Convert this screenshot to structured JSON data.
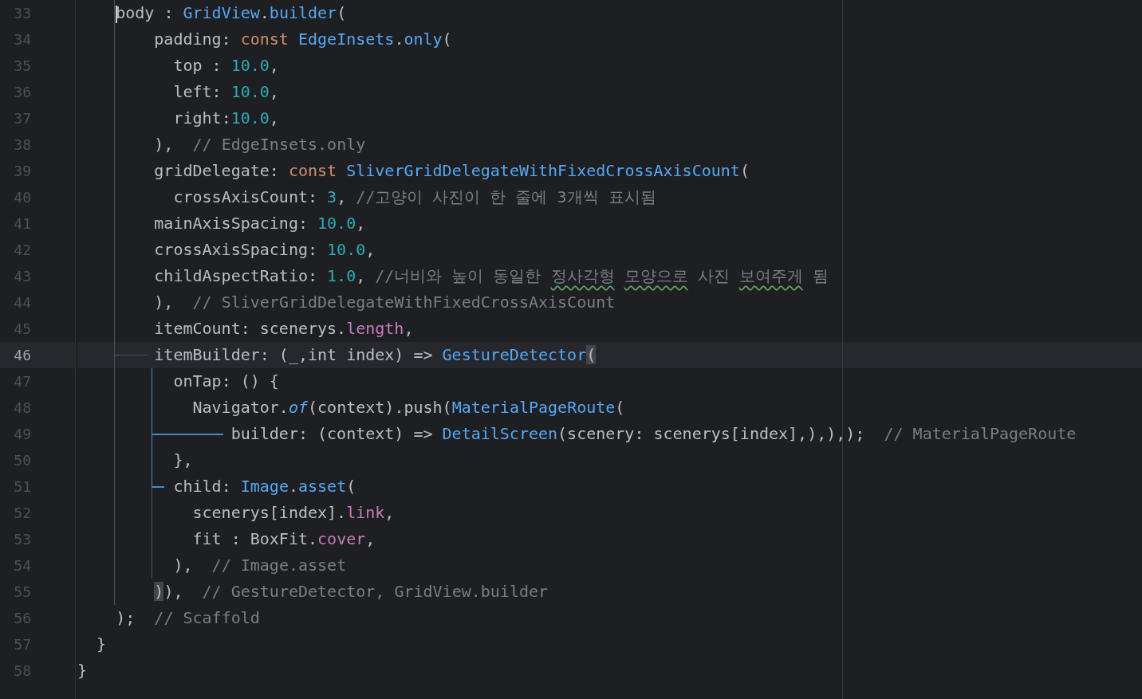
{
  "lines": [
    {
      "number": "33",
      "current": false,
      "caret": true,
      "tokens": [
        {
          "kind": "plain",
          "text": "    body : "
        },
        {
          "kind": "call",
          "text": "GridView"
        },
        {
          "kind": "plain",
          "text": "."
        },
        {
          "kind": "call",
          "text": "builder"
        },
        {
          "kind": "plain",
          "text": "("
        }
      ]
    },
    {
      "number": "34",
      "current": false,
      "tokens": [
        {
          "kind": "plain",
          "text": "        padding: "
        },
        {
          "kind": "keyword",
          "text": "const"
        },
        {
          "kind": "call",
          "text": " EdgeInsets"
        },
        {
          "kind": "plain",
          "text": "."
        },
        {
          "kind": "call",
          "text": "only"
        },
        {
          "kind": "plain",
          "text": "("
        }
      ]
    },
    {
      "number": "35",
      "current": false,
      "tokens": [
        {
          "kind": "plain",
          "text": "          top : "
        },
        {
          "kind": "number",
          "text": "10.0"
        },
        {
          "kind": "plain",
          "text": ","
        }
      ]
    },
    {
      "number": "36",
      "current": false,
      "tokens": [
        {
          "kind": "plain",
          "text": "          left: "
        },
        {
          "kind": "number",
          "text": "10.0"
        },
        {
          "kind": "plain",
          "text": ","
        }
      ]
    },
    {
      "number": "37",
      "current": false,
      "tokens": [
        {
          "kind": "plain",
          "text": "          right:"
        },
        {
          "kind": "number",
          "text": "10.0"
        },
        {
          "kind": "plain",
          "text": ","
        }
      ]
    },
    {
      "number": "38",
      "current": false,
      "tokens": [
        {
          "kind": "plain",
          "text": "        ),  "
        },
        {
          "kind": "comment",
          "text": "// EdgeInsets.only"
        }
      ]
    },
    {
      "number": "39",
      "current": false,
      "tokens": [
        {
          "kind": "plain",
          "text": "        gridDelegate: "
        },
        {
          "kind": "keyword",
          "text": "const"
        },
        {
          "kind": "call",
          "text": " SliverGridDelegateWithFixedCrossAxisCount"
        },
        {
          "kind": "plain",
          "text": "("
        }
      ]
    },
    {
      "number": "40",
      "current": false,
      "tokens": [
        {
          "kind": "plain",
          "text": "          crossAxisCount: "
        },
        {
          "kind": "number",
          "text": "3"
        },
        {
          "kind": "plain",
          "text": ", "
        },
        {
          "kind": "comment",
          "text": "//고양이 사진이 한 줄에 3개씩 표시됨"
        }
      ]
    },
    {
      "number": "41",
      "current": false,
      "tokens": [
        {
          "kind": "plain",
          "text": "        mainAxisSpacing: "
        },
        {
          "kind": "number",
          "text": "10.0"
        },
        {
          "kind": "plain",
          "text": ","
        }
      ]
    },
    {
      "number": "42",
      "current": false,
      "tokens": [
        {
          "kind": "plain",
          "text": "        crossAxisSpacing: "
        },
        {
          "kind": "number",
          "text": "10.0"
        },
        {
          "kind": "plain",
          "text": ","
        }
      ]
    },
    {
      "number": "43",
      "current": false,
      "tokens": [
        {
          "kind": "plain",
          "text": "        childAspectRatio: "
        },
        {
          "kind": "number",
          "text": "1.0"
        },
        {
          "kind": "plain",
          "text": ", "
        },
        {
          "kind": "comment",
          "text": "//너비와 높이 동일한 "
        },
        {
          "kind": "typo",
          "text": "정사각형 "
        },
        {
          "kind": "typo",
          "text": "모양으로"
        },
        {
          "kind": "comment",
          "text": " 사진 "
        },
        {
          "kind": "typo",
          "text": "보여주게"
        },
        {
          "kind": "comment",
          "text": " 됨"
        }
      ]
    },
    {
      "number": "44",
      "current": false,
      "tokens": [
        {
          "kind": "plain",
          "text": "        ),  "
        },
        {
          "kind": "comment",
          "text": "// SliverGridDelegateWithFixedCrossAxisCount"
        }
      ]
    },
    {
      "number": "45",
      "current": false,
      "tokens": [
        {
          "kind": "plain",
          "text": "        itemCount: scenerys."
        },
        {
          "kind": "field",
          "text": "length"
        },
        {
          "kind": "plain",
          "text": ","
        }
      ]
    },
    {
      "number": "46",
      "current": true,
      "tokens": [
        {
          "kind": "plain",
          "text": "        itemBuilder: (_,int index) => "
        },
        {
          "kind": "call",
          "text": "GestureDetector"
        },
        {
          "kind": "match",
          "text": "("
        }
      ]
    },
    {
      "number": "47",
      "current": false,
      "tokens": [
        {
          "kind": "plain",
          "text": "          onTap: () {"
        }
      ]
    },
    {
      "number": "48",
      "current": false,
      "tokens": [
        {
          "kind": "plain",
          "text": "            Navigator."
        },
        {
          "kind": "static",
          "text": "of"
        },
        {
          "kind": "plain",
          "text": "(context).push("
        },
        {
          "kind": "call",
          "text": "MaterialPageRoute"
        },
        {
          "kind": "plain",
          "text": "("
        }
      ]
    },
    {
      "number": "49",
      "current": false,
      "tokens": [
        {
          "kind": "plain",
          "text": "                builder: (context) => "
        },
        {
          "kind": "call",
          "text": "DetailScreen"
        },
        {
          "kind": "plain",
          "text": "(scenery: scenerys[index],),),);  "
        },
        {
          "kind": "comment",
          "text": "// MaterialPageRoute"
        }
      ]
    },
    {
      "number": "50",
      "current": false,
      "tokens": [
        {
          "kind": "plain",
          "text": "          },"
        }
      ]
    },
    {
      "number": "51",
      "current": false,
      "tokens": [
        {
          "kind": "plain",
          "text": "          child: "
        },
        {
          "kind": "call",
          "text": "Image"
        },
        {
          "kind": "plain",
          "text": "."
        },
        {
          "kind": "call",
          "text": "asset"
        },
        {
          "kind": "plain",
          "text": "("
        }
      ]
    },
    {
      "number": "52",
      "current": false,
      "tokens": [
        {
          "kind": "plain",
          "text": "            scenerys[index]."
        },
        {
          "kind": "field",
          "text": "link"
        },
        {
          "kind": "plain",
          "text": ","
        }
      ]
    },
    {
      "number": "53",
      "current": false,
      "tokens": [
        {
          "kind": "plain",
          "text": "            fit : BoxFit."
        },
        {
          "kind": "field",
          "text": "cover"
        },
        {
          "kind": "plain",
          "text": ","
        }
      ]
    },
    {
      "number": "54",
      "current": false,
      "tokens": [
        {
          "kind": "plain",
          "text": "          ),  "
        },
        {
          "kind": "comment",
          "text": "// Image.asset"
        }
      ]
    },
    {
      "number": "55",
      "current": false,
      "tokens": [
        {
          "kind": "match",
          "text": "        )"
        },
        {
          "kind": "plain",
          "text": "),  "
        },
        {
          "kind": "comment",
          "text": "// GestureDetector, GridView.builder"
        }
      ]
    },
    {
      "number": "56",
      "current": false,
      "tokens": [
        {
          "kind": "plain",
          "text": "    );  "
        },
        {
          "kind": "comment",
          "text": "// Scaffold"
        }
      ]
    },
    {
      "number": "57",
      "current": false,
      "tokens": [
        {
          "kind": "plain",
          "text": "  }"
        }
      ]
    },
    {
      "number": "58",
      "current": false,
      "tokens": [
        {
          "kind": "plain",
          "text": "}"
        }
      ]
    }
  ]
}
